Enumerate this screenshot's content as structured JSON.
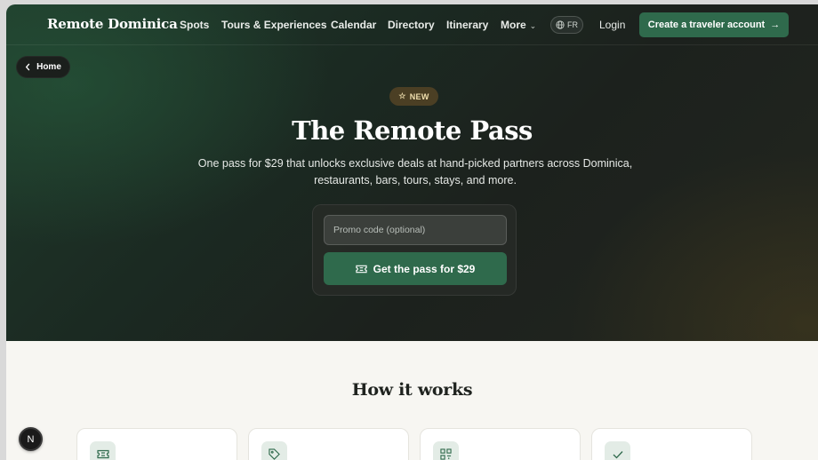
{
  "nav": {
    "brand": "Remote Dominica",
    "links": [
      "Spots",
      "Tours & Experiences",
      "Calendar",
      "Directory",
      "Itinerary",
      "More"
    ],
    "language": "FR",
    "login": "Login",
    "cta": "Create a traveler account",
    "cta_arrow": "→"
  },
  "back": {
    "label": "Home",
    "icon": "chevron-left-icon"
  },
  "hero": {
    "badge": "NEW",
    "badge_icon": "star-icon",
    "title": "The Remote Pass",
    "subtitle": "One pass for $29 that unlocks exclusive deals at hand-picked partners across Dominica, restaurants, bars, tours, stays, and more.",
    "promo_placeholder": "Promo code (optional)",
    "button": "Get the pass for $29",
    "button_icon": "ticket-icon"
  },
  "how": {
    "title": "How it works",
    "step_icons": [
      "ticket-icon",
      "tag-icon",
      "qr-code-icon",
      "check-icon"
    ]
  },
  "floating_badge": "N",
  "colors": {
    "accent": "#2f6a4c",
    "hero_dark": "#1c211d",
    "page_bg": "#f7f6f2",
    "badge_bg": "#4b3f24",
    "badge_text": "#f0dfae"
  }
}
